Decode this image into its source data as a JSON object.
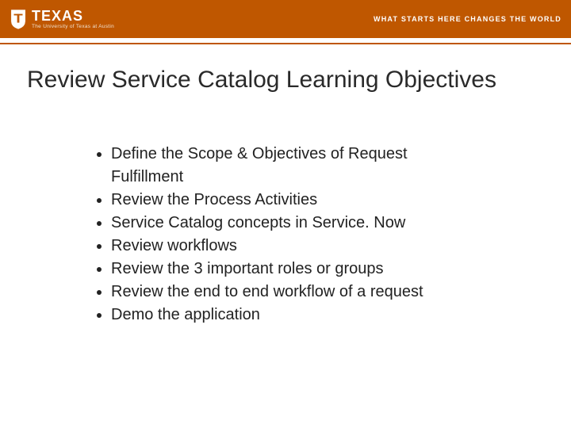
{
  "header": {
    "brand_main": "TEXAS",
    "brand_sub": "The University of Texas at Austin",
    "tagline": "WHAT STARTS HERE CHANGES THE WORLD"
  },
  "title": "Review Service Catalog Learning Objectives",
  "bullets": [
    "Define the Scope & Objectives of Request Fulfillment",
    "Review the Process Activities",
    "Service Catalog concepts in Service. Now",
    "Review workflows",
    "Review the 3 important roles or groups",
    "Review the end to end workflow of a request",
    "Demo the application"
  ],
  "colors": {
    "accent": "#bf5700"
  }
}
